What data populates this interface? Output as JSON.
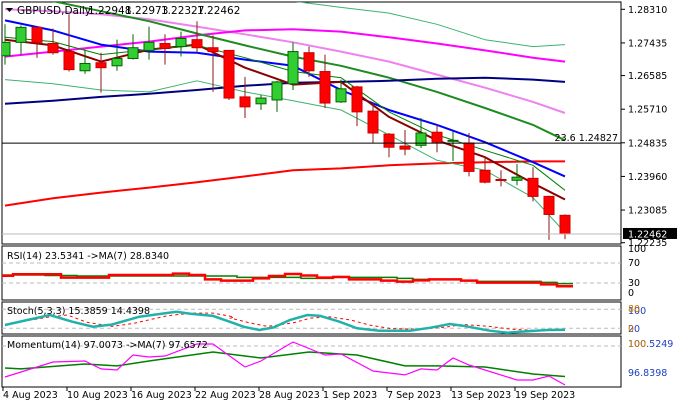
{
  "header": {
    "symbol_label": "GBPUSD,Daily",
    "open": "1.22948",
    "high": "1.22973",
    "low": "1.22327",
    "close": "1.22462"
  },
  "chart_data": {
    "type": "candlestick",
    "title": "GBPUSD,Daily",
    "ylim": [
      1.22235,
      1.2831
    ],
    "price_ticks": [
      "1.28310",
      "1.27435",
      "1.26585",
      "1.25710",
      "1.24835",
      "1.23960",
      "1.23085",
      "1.22235"
    ],
    "current_price": "1.22462",
    "fib_level": {
      "label": "23.6 1.24827",
      "value": 1.24827
    },
    "x_tick_labels": [
      {
        "index": 1,
        "label": "4 Aug 2023"
      },
      {
        "index": 5,
        "label": "10 Aug 2023"
      },
      {
        "index": 9,
        "label": "16 Aug 2023"
      },
      {
        "index": 13,
        "label": "22 Aug 2023"
      },
      {
        "index": 17,
        "label": "28 Aug 2023"
      },
      {
        "index": 21,
        "label": "1 Sep 2023"
      },
      {
        "index": 25,
        "label": "7 Sep 2023"
      },
      {
        "index": 29,
        "label": "13 Sep 2023"
      },
      {
        "index": 33,
        "label": "19 Sep 2023"
      }
    ],
    "candles_ohlc": [
      [
        1.271,
        1.2792,
        1.2687,
        1.2745
      ],
      [
        1.2745,
        1.2789,
        1.2713,
        1.2784
      ],
      [
        1.2784,
        1.2784,
        1.2705,
        1.2745
      ],
      [
        1.2742,
        1.2781,
        1.2713,
        1.2718
      ],
      [
        1.2721,
        1.2818,
        1.2669,
        1.2674
      ],
      [
        1.2671,
        1.2726,
        1.2663,
        1.269
      ],
      [
        1.2692,
        1.2718,
        1.2614,
        1.2679
      ],
      [
        1.2684,
        1.2752,
        1.2671,
        1.2703
      ],
      [
        1.2703,
        1.2766,
        1.27,
        1.2731
      ],
      [
        1.2724,
        1.2786,
        1.27,
        1.2745
      ],
      [
        1.2742,
        1.2766,
        1.2687,
        1.2729
      ],
      [
        1.2734,
        1.2773,
        1.2708,
        1.2755
      ],
      [
        1.2752,
        1.28,
        1.2718,
        1.2731
      ],
      [
        1.2731,
        1.2763,
        1.2616,
        1.2721
      ],
      [
        1.2724,
        1.2724,
        1.2595,
        1.26
      ],
      [
        1.2603,
        1.2655,
        1.2548,
        1.2577
      ],
      [
        1.2585,
        1.2608,
        1.2569,
        1.26
      ],
      [
        1.2595,
        1.2645,
        1.2564,
        1.2642
      ],
      [
        1.2637,
        1.2745,
        1.2621,
        1.2721
      ],
      [
        1.2718,
        1.2734,
        1.2655,
        1.2671
      ],
      [
        1.2669,
        1.2713,
        1.2574,
        1.2587
      ],
      [
        1.259,
        1.2648,
        1.2587,
        1.2624
      ],
      [
        1.2629,
        1.2632,
        1.2527,
        1.2564
      ],
      [
        1.2566,
        1.2587,
        1.2483,
        1.2509
      ],
      [
        1.2506,
        1.2509,
        1.2446,
        1.2472
      ],
      [
        1.2475,
        1.2517,
        1.2451,
        1.2467
      ],
      [
        1.2477,
        1.2548,
        1.247,
        1.2509
      ],
      [
        1.2511,
        1.253,
        1.2459,
        1.2485
      ],
      [
        1.2488,
        1.2514,
        1.2436,
        1.249
      ],
      [
        1.2483,
        1.2509,
        1.2396,
        1.2409
      ],
      [
        1.2412,
        1.2449,
        1.2378,
        1.2381
      ],
      [
        1.2388,
        1.2412,
        1.237,
        1.2386
      ],
      [
        1.2386,
        1.2428,
        1.2373,
        1.2394
      ],
      [
        1.2391,
        1.242,
        1.2331,
        1.2344
      ],
      [
        1.2344,
        1.2346,
        1.2231,
        1.2297
      ],
      [
        1.22948,
        1.22973,
        1.22327,
        1.22462
      ]
    ],
    "ma_sample_indices": [
      1,
      4,
      7,
      10,
      13,
      16,
      19,
      22,
      25,
      28,
      31,
      34,
      36
    ],
    "ma_lines": [
      {
        "name": "violet-ma",
        "color": "#ee82ee",
        "width": 2,
        "values": [
          1.2831,
          1.2826,
          1.2818,
          1.2805,
          1.2786,
          1.2766,
          1.2745,
          1.2721,
          1.2695,
          1.2661,
          1.2627,
          1.259,
          1.2561
        ]
      },
      {
        "name": "magenta-ma",
        "color": "#ff00ff",
        "width": 2,
        "values": [
          1.2708,
          1.2721,
          1.2734,
          1.2747,
          1.2763,
          1.2776,
          1.2779,
          1.2773,
          1.2758,
          1.2742,
          1.2724,
          1.2705,
          1.2695
        ]
      },
      {
        "name": "green-ma",
        "color": "#1e8c1e",
        "width": 2,
        "values": [
          1.2878,
          1.2852,
          1.2826,
          1.28,
          1.2768,
          1.2737,
          1.2708,
          1.2684,
          1.2653,
          1.2616,
          1.2574,
          1.253,
          1.249
        ]
      },
      {
        "name": "navy-ma",
        "color": "#000080",
        "width": 2,
        "values": [
          1.2585,
          1.2593,
          1.2603,
          1.2611,
          1.2621,
          1.2632,
          1.264,
          1.2642,
          1.2645,
          1.265,
          1.2653,
          1.2648,
          1.2642
        ]
      },
      {
        "name": "red-ma",
        "color": "#ff0000",
        "width": 2,
        "values": [
          1.232,
          1.2339,
          1.2354,
          1.2367,
          1.2381,
          1.2396,
          1.2412,
          1.2417,
          1.2425,
          1.243,
          1.2433,
          1.2435,
          1.2435
        ]
      },
      {
        "name": "blue-ma",
        "color": "#0000ff",
        "width": 2,
        "values": [
          1.2802,
          1.2776,
          1.2739,
          1.2721,
          1.2718,
          1.27,
          1.2684,
          1.2621,
          1.2569,
          1.253,
          1.2485,
          1.2433,
          1.2396
        ]
      },
      {
        "name": "darkred-ma",
        "color": "#8b0000",
        "width": 2,
        "values": [
          1.2752,
          1.2737,
          1.2695,
          1.2726,
          1.2739,
          1.2679,
          1.2635,
          1.2642,
          1.2551,
          1.249,
          1.2446,
          1.2378,
          1.2336
        ]
      },
      {
        "name": "band-mid",
        "color": "#008000",
        "width": 1,
        "values": [
          1.2758,
          1.2747,
          1.2713,
          1.2726,
          1.2737,
          1.2705,
          1.2669,
          1.2653,
          1.2564,
          1.2504,
          1.2464,
          1.2425,
          1.236
        ]
      },
      {
        "name": "band-lower",
        "color": "#3cb371",
        "width": 1,
        "values": [
          1.2648,
          1.2637,
          1.2621,
          1.2616,
          1.2645,
          1.2616,
          1.2593,
          1.2569,
          1.2504,
          1.2438,
          1.2412,
          1.2341,
          1.225
        ]
      },
      {
        "name": "band-upper",
        "color": "#3cb371",
        "width": 1,
        "values": [
          null,
          null,
          null,
          null,
          null,
          null,
          1.2852,
          1.2836,
          1.2821,
          1.2792,
          1.2752,
          1.2734,
          1.2739
        ]
      }
    ],
    "rsi": {
      "label": "RSI(14) 23.5341  ->MA(7) 28.8340",
      "levels": [
        "100",
        "70",
        "30",
        "0"
      ],
      "rsi_values": [
        44.6,
        47.4,
        47.4,
        47.4,
        40.7,
        40.7,
        40.7,
        46,
        46,
        46,
        46,
        48.7,
        46,
        37.3,
        34.7,
        34.7,
        39.3,
        44,
        48,
        45,
        40.7,
        42,
        37.3,
        37.3,
        34.7,
        32.7,
        35.3,
        37.3,
        37.3,
        34.7,
        30.7,
        30.7,
        30.7,
        30.7,
        27.3,
        23.5341
      ],
      "ma_values": [
        46,
        46,
        46,
        45,
        45,
        44,
        44,
        44,
        44,
        44,
        44,
        44,
        44,
        44,
        44,
        41.3,
        41.3,
        41.3,
        41.3,
        39.3,
        39.3,
        42.7,
        41.3,
        41.3,
        41.3,
        39.3,
        37.3,
        37.3,
        37.3,
        35.3,
        33.3,
        33.3,
        33.3,
        33.3,
        31.3,
        28.834
      ]
    },
    "stoch": {
      "label": "Stoch(5,3,3) 15.3859 14.4398",
      "levels": [
        "100",
        "80",
        "20",
        "0"
      ],
      "main_points": [
        [
          1,
          30.4
        ],
        [
          2.4,
          46
        ],
        [
          3.8,
          62
        ],
        [
          5.2,
          40.8
        ],
        [
          6.5,
          25
        ],
        [
          7.7,
          32
        ],
        [
          9.4,
          56.6
        ],
        [
          11.7,
          72.4
        ],
        [
          12.6,
          66
        ],
        [
          14,
          59
        ],
        [
          15.3,
          36
        ],
        [
          15.9,
          25
        ],
        [
          16.9,
          14.6
        ],
        [
          17.8,
          22.8
        ],
        [
          18.8,
          46
        ],
        [
          19.9,
          62
        ],
        [
          20.7,
          59
        ],
        [
          21.9,
          40.8
        ],
        [
          23,
          20
        ],
        [
          24.4,
          12.4
        ],
        [
          26.3,
          12.4
        ],
        [
          27.6,
          21.9
        ],
        [
          28.8,
          33.6
        ],
        [
          29.6,
          28
        ],
        [
          31.3,
          12.4
        ],
        [
          32.4,
          6
        ],
        [
          33.2,
          9
        ],
        [
          34.9,
          14.6
        ],
        [
          36,
          15.3859
        ]
      ],
      "signal_points": [
        [
          1,
          28
        ],
        [
          1.9,
          40
        ],
        [
          3.8,
          56
        ],
        [
          4.9,
          62
        ],
        [
          6.1,
          39
        ],
        [
          7.7,
          26
        ],
        [
          9,
          35
        ],
        [
          11.1,
          59
        ],
        [
          12.6,
          68
        ],
        [
          14,
          68
        ],
        [
          15.3,
          56
        ],
        [
          15.1,
          52
        ],
        [
          16.3,
          37
        ],
        [
          17.4,
          26
        ],
        [
          19,
          37
        ],
        [
          20.1,
          52
        ],
        [
          21.3,
          56
        ],
        [
          22.6,
          46
        ],
        [
          23.8,
          30
        ],
        [
          25.1,
          19
        ],
        [
          26.8,
          17
        ],
        [
          28.6,
          24
        ],
        [
          29.6,
          32
        ],
        [
          31.3,
          26
        ],
        [
          32.6,
          17
        ],
        [
          34.3,
          13
        ],
        [
          36,
          14.4398
        ]
      ]
    },
    "momentum": {
      "label": "Momentum(14) 97.0073  ->MA(7) 97.6572",
      "levels": [
        "100.5249",
        "100",
        "96.8398"
      ],
      "mom_points": [
        [
          1,
          97.62
        ],
        [
          4,
          98.77
        ],
        [
          6,
          98.85
        ],
        [
          7,
          98.24
        ],
        [
          8,
          98.16
        ],
        [
          9,
          99.31
        ],
        [
          10,
          99.16
        ],
        [
          11,
          99.23
        ],
        [
          13,
          100.15
        ],
        [
          14,
          100.15
        ],
        [
          16,
          98.39
        ],
        [
          17,
          98.85
        ],
        [
          19,
          100.31
        ],
        [
          21,
          99.31
        ],
        [
          22,
          99.39
        ],
        [
          24,
          98.08
        ],
        [
          26,
          97.78
        ],
        [
          27,
          98.24
        ],
        [
          28,
          98.16
        ],
        [
          29,
          99.08
        ],
        [
          30,
          98.54
        ],
        [
          33,
          97.39
        ],
        [
          34,
          97.39
        ],
        [
          35,
          97.7
        ],
        [
          36,
          97.0073
        ]
      ],
      "ma_points": [
        [
          1,
          98.31
        ],
        [
          2,
          98.24
        ],
        [
          6,
          98.62
        ],
        [
          8,
          98.47
        ],
        [
          10,
          98.85
        ],
        [
          14,
          99.54
        ],
        [
          17,
          99.08
        ],
        [
          20,
          99.54
        ],
        [
          23,
          99.31
        ],
        [
          26,
          98.47
        ],
        [
          28,
          98.47
        ],
        [
          31,
          98.39
        ],
        [
          34,
          97.85
        ],
        [
          36,
          97.6572
        ]
      ]
    }
  }
}
